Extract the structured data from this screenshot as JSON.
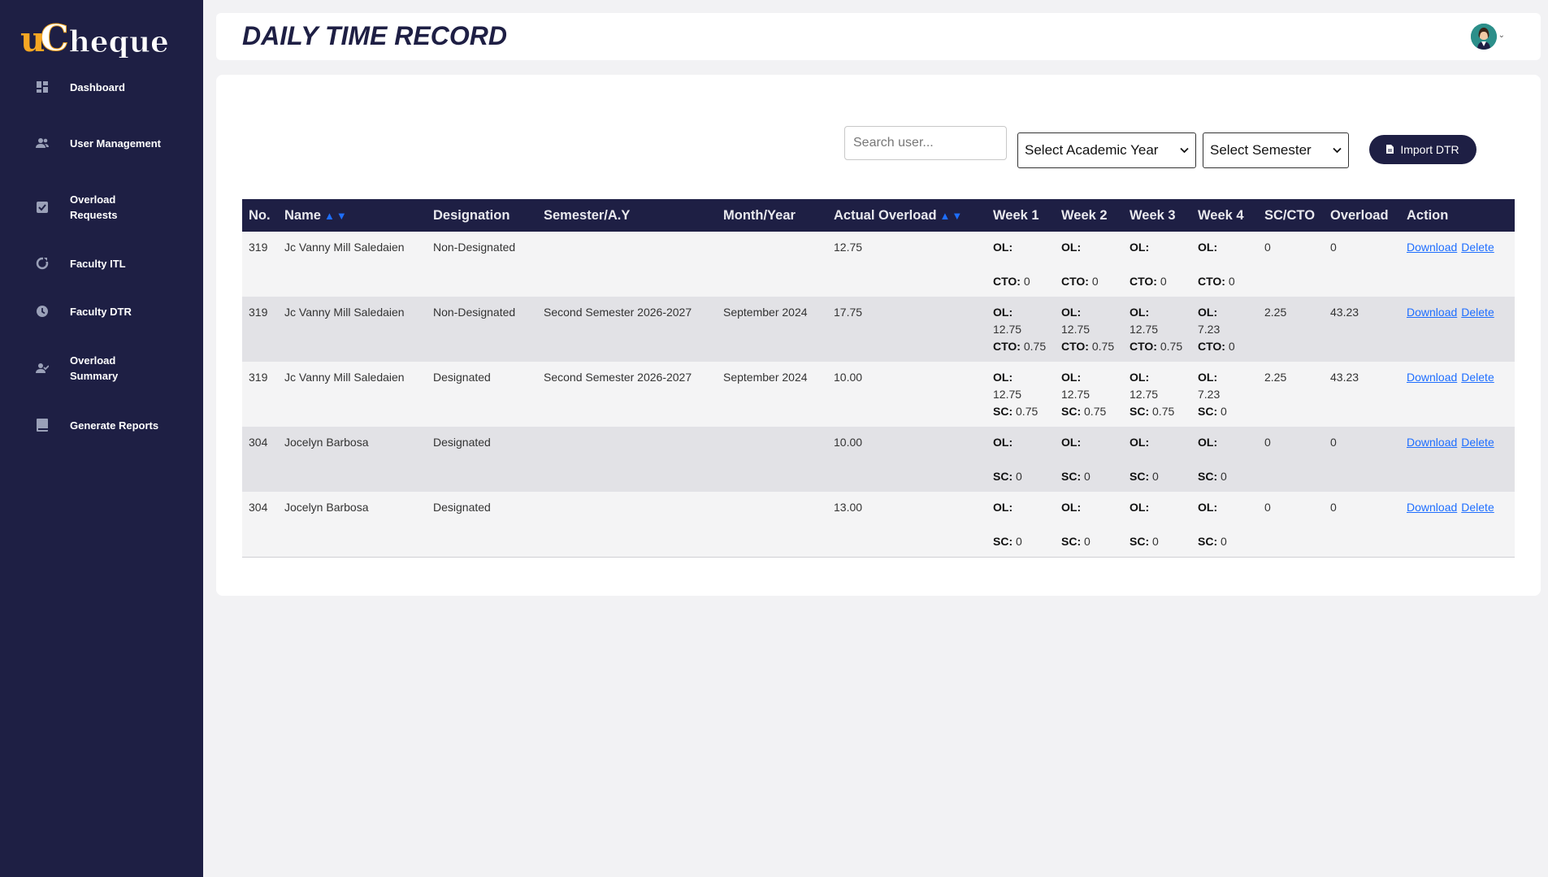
{
  "brand": {
    "logo_u": "u",
    "logo_c": "C",
    "logo_rest": "heque",
    "accent_color": "#f5a623",
    "sidebar_color": "#1e1f44"
  },
  "sidebar": {
    "items": [
      {
        "label": "Dashboard",
        "icon": "dashboard-grid-icon"
      },
      {
        "label": "User Management",
        "icon": "users-icon"
      },
      {
        "label": "Overload Requests",
        "icon": "checklist-icon"
      },
      {
        "label": "Faculty ITL",
        "icon": "refresh-icon"
      },
      {
        "label": "Faculty DTR",
        "icon": "clock-icon"
      },
      {
        "label": "Overload Summary",
        "icon": "user-check-icon"
      },
      {
        "label": "Generate Reports",
        "icon": "book-icon"
      }
    ]
  },
  "header": {
    "title": "DAILY TIME RECORD",
    "avatar_icon": "user-avatar-icon"
  },
  "toolbar": {
    "search_placeholder": "Search user...",
    "academic_year_select": "Select Academic Year",
    "semester_select": "Select Semester",
    "import_label": "Import DTR"
  },
  "table": {
    "columns": [
      "No.",
      "Name",
      "Designation",
      "Semester/A.Y",
      "Month/Year",
      "Actual Overload",
      "Week 1",
      "Week 2",
      "Week 3",
      "Week 4",
      "SC/CTO",
      "Overload",
      "Action"
    ],
    "sort_up": "▲",
    "sort_down": "▼",
    "actions": {
      "download": "Download",
      "delete": "Delete"
    },
    "rows": [
      {
        "no": "319",
        "name": "Jc Vanny Mill Saledaien",
        "designation": "Non-Designated",
        "semester": "",
        "month": "",
        "actual": "12.75",
        "weeks": [
          {
            "ol_label": "OL:",
            "ol": "",
            "sub_label": "CTO:",
            "sub": "0"
          },
          {
            "ol_label": "OL:",
            "ol": "",
            "sub_label": "CTO:",
            "sub": "0"
          },
          {
            "ol_label": "OL:",
            "ol": "",
            "sub_label": "CTO:",
            "sub": "0"
          },
          {
            "ol_label": "OL:",
            "ol": "",
            "sub_label": "CTO:",
            "sub": "0"
          }
        ],
        "sccto": "0",
        "overload": "0"
      },
      {
        "no": "319",
        "name": "Jc Vanny Mill Saledaien",
        "designation": "Non-Designated",
        "semester": "Second Semester 2026-2027",
        "month": "September 2024",
        "actual": "17.75",
        "weeks": [
          {
            "ol_label": "OL:",
            "ol": "12.75",
            "sub_label": "CTO:",
            "sub": "0.75"
          },
          {
            "ol_label": "OL:",
            "ol": "12.75",
            "sub_label": "CTO:",
            "sub": "0.75"
          },
          {
            "ol_label": "OL:",
            "ol": "12.75",
            "sub_label": "CTO:",
            "sub": "0.75"
          },
          {
            "ol_label": "OL:",
            "ol": "7.23",
            "sub_label": "CTO:",
            "sub": "0"
          }
        ],
        "sccto": "2.25",
        "overload": "43.23"
      },
      {
        "no": "319",
        "name": "Jc Vanny Mill Saledaien",
        "designation": "Designated",
        "semester": "Second Semester 2026-2027",
        "month": "September 2024",
        "actual": "10.00",
        "weeks": [
          {
            "ol_label": "OL:",
            "ol": "12.75",
            "sub_label": "SC:",
            "sub": "0.75"
          },
          {
            "ol_label": "OL:",
            "ol": "12.75",
            "sub_label": "SC:",
            "sub": "0.75"
          },
          {
            "ol_label": "OL:",
            "ol": "12.75",
            "sub_label": "SC:",
            "sub": "0.75"
          },
          {
            "ol_label": "OL:",
            "ol": "7.23",
            "sub_label": "SC:",
            "sub": "0"
          }
        ],
        "sccto": "2.25",
        "overload": "43.23"
      },
      {
        "no": "304",
        "name": "Jocelyn Barbosa",
        "designation": "Designated",
        "semester": "",
        "month": "",
        "actual": "10.00",
        "weeks": [
          {
            "ol_label": "OL:",
            "ol": "",
            "sub_label": "SC:",
            "sub": "0"
          },
          {
            "ol_label": "OL:",
            "ol": "",
            "sub_label": "SC:",
            "sub": "0"
          },
          {
            "ol_label": "OL:",
            "ol": "",
            "sub_label": "SC:",
            "sub": "0"
          },
          {
            "ol_label": "OL:",
            "ol": "",
            "sub_label": "SC:",
            "sub": "0"
          }
        ],
        "sccto": "0",
        "overload": "0"
      },
      {
        "no": "304",
        "name": "Jocelyn Barbosa",
        "designation": "Designated",
        "semester": "",
        "month": "",
        "actual": "13.00",
        "weeks": [
          {
            "ol_label": "OL:",
            "ol": "",
            "sub_label": "SC:",
            "sub": "0"
          },
          {
            "ol_label": "OL:",
            "ol": "",
            "sub_label": "SC:",
            "sub": "0"
          },
          {
            "ol_label": "OL:",
            "ol": "",
            "sub_label": "SC:",
            "sub": "0"
          },
          {
            "ol_label": "OL:",
            "ol": "",
            "sub_label": "SC:",
            "sub": "0"
          }
        ],
        "sccto": "0",
        "overload": "0"
      }
    ]
  }
}
